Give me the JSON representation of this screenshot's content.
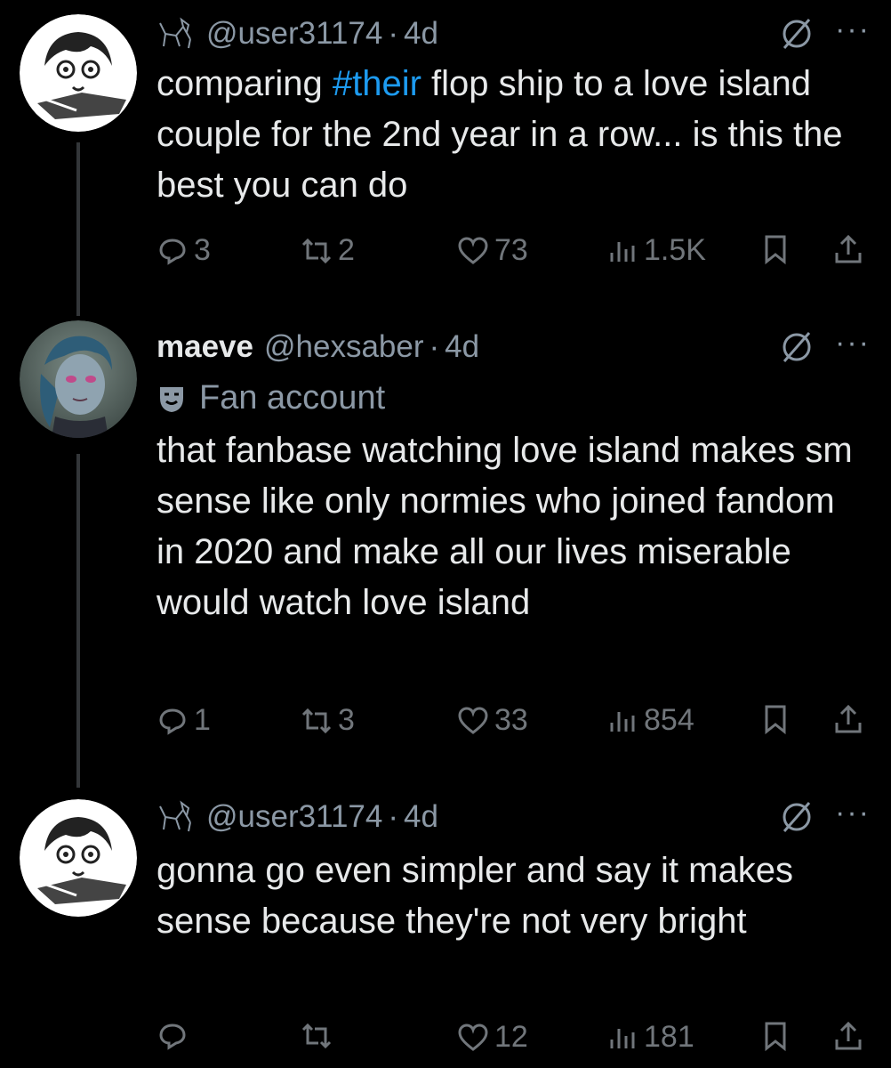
{
  "replies": [
    {
      "display_name": "",
      "handle": "@user31174",
      "time": "4d",
      "label": "",
      "text_before": "comparing ",
      "hashtag": "#their",
      "text_after": " flop ship to a love island couple for the 2nd year in a row... is this the best you can do",
      "stats": {
        "replies": "3",
        "reposts": "2",
        "likes": "73",
        "views": "1.5K"
      }
    },
    {
      "display_name": "maeve",
      "handle": "@hexsaber",
      "time": "4d",
      "label": "Fan account",
      "text": "that fanbase watching love island makes sm sense like only normies who joined fandom in 2020 and make all our lives miserable would watch love island",
      "stats": {
        "replies": "1",
        "reposts": "3",
        "likes": "33",
        "views": "854"
      }
    },
    {
      "display_name": "",
      "handle": "@user31174",
      "time": "4d",
      "label": "",
      "text": "gonna go even simpler and say it makes sense because they're not very bright",
      "stats": {
        "replies": "",
        "reposts": "",
        "likes": "12",
        "views": "181"
      }
    }
  ],
  "ui": {
    "dot": "·",
    "more": "···"
  },
  "colors": {
    "background": "#000000",
    "text": "#e7e9ea",
    "secondary": "#71767b",
    "hashtag": "#1d9bf0",
    "thread_line": "#333639"
  },
  "icons": [
    "cat-label-icon",
    "mute-icon",
    "more-icon",
    "reply-icon",
    "repost-icon",
    "like-icon",
    "views-icon",
    "bookmark-icon",
    "share-icon",
    "mask-icon"
  ]
}
